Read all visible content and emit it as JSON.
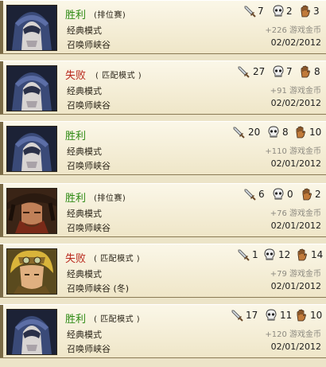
{
  "matches": [
    {
      "result": "胜利",
      "result_type": "win",
      "queue": "(排位赛)",
      "mode": "经典模式",
      "map": "召唤师峡谷",
      "kills": "7",
      "deaths": "2",
      "assists": "3",
      "gold": "+226 游戏金币",
      "date": "02/02/2012",
      "champion_icon": "hooded-assassin-portrait"
    },
    {
      "result": "失败",
      "result_type": "loss",
      "queue": "( 匹配模式 )",
      "mode": "经典模式",
      "map": "召唤师峡谷",
      "kills": "27",
      "deaths": "7",
      "assists": "8",
      "gold": "+91 游戏金币",
      "date": "02/02/2012",
      "champion_icon": "hooded-assassin-portrait"
    },
    {
      "result": "胜利",
      "result_type": "win",
      "queue": "",
      "mode": "经典模式",
      "map": "召唤师峡谷",
      "kills": "20",
      "deaths": "8",
      "assists": "10",
      "gold": "+110 游戏金币",
      "date": "02/01/2012",
      "champion_icon": "hooded-assassin-portrait"
    },
    {
      "result": "胜利",
      "result_type": "win",
      "queue": "(排位赛)",
      "mode": "经典模式",
      "map": "召唤师峡谷",
      "kills": "6",
      "deaths": "0",
      "assists": "2",
      "gold": "+76 游戏金币",
      "date": "02/01/2012",
      "champion_icon": "pirate-captain-portrait"
    },
    {
      "result": "失败",
      "result_type": "loss",
      "queue": "( 匹配模式 )",
      "mode": "经典模式",
      "map": "召唤师峡谷 (冬)",
      "kills": "1",
      "deaths": "12",
      "assists": "14",
      "gold": "+79 游戏金币",
      "date": "02/01/2012",
      "champion_icon": "goggled-gunner-portrait"
    },
    {
      "result": "胜利",
      "result_type": "win",
      "queue": "( 匹配模式 )",
      "mode": "经典模式",
      "map": "召唤师峡谷",
      "kills": "17",
      "deaths": "11",
      "assists": "10",
      "gold": "+120 游戏金币",
      "date": "02/01/2012",
      "champion_icon": "hooded-assassin-portrait"
    }
  ],
  "icons": {
    "kills": "sword-icon",
    "deaths": "skull-icon",
    "assists": "hand-icon"
  },
  "colors": {
    "win": "#2f8a14",
    "loss": "#b8281c",
    "gold_text": "#8d8a80"
  }
}
